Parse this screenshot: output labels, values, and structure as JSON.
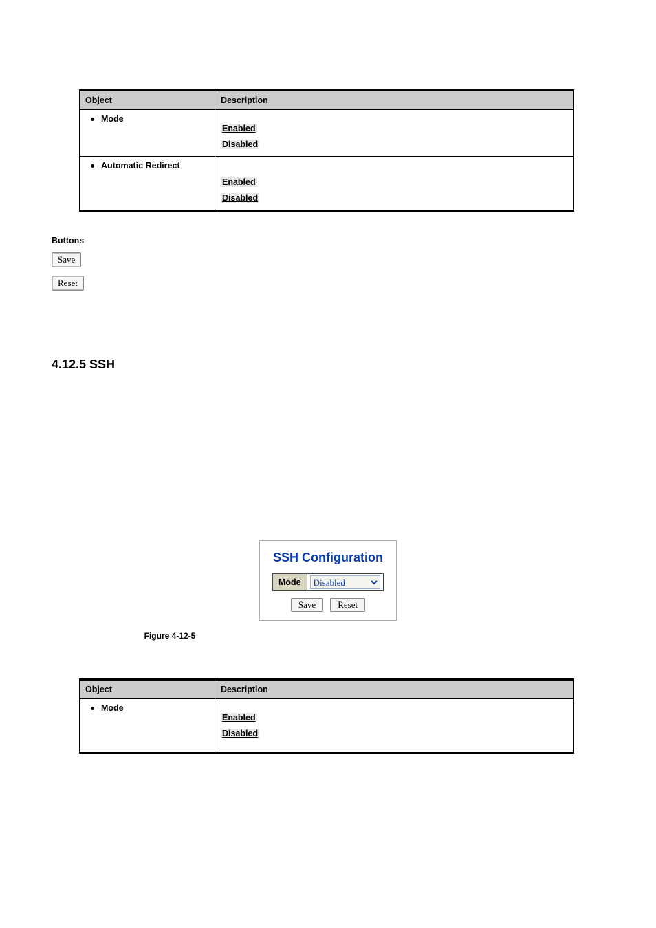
{
  "table1": {
    "headers": {
      "object": "Object",
      "description": "Description"
    },
    "rows": [
      {
        "object": "Mode",
        "opts": {
          "enabled": "Enabled",
          "disabled": "Disabled"
        }
      },
      {
        "object": "Automatic Redirect",
        "opts": {
          "enabled": "Enabled",
          "disabled": "Disabled"
        }
      }
    ]
  },
  "buttons_section": {
    "label": "Buttons",
    "save": "Save",
    "reset": "Reset"
  },
  "section_heading": "4.12.5 SSH",
  "ssh_panel": {
    "title": "SSH Configuration",
    "mode_label": "Mode",
    "mode_value": "Disabled",
    "save": "Save",
    "reset": "Reset"
  },
  "figure_caption": "Figure 4-12-5",
  "table2": {
    "headers": {
      "object": "Object",
      "description": "Description"
    },
    "rows": [
      {
        "object": "Mode",
        "opts": {
          "enabled": "Enabled",
          "disabled": "Disabled"
        }
      }
    ]
  }
}
